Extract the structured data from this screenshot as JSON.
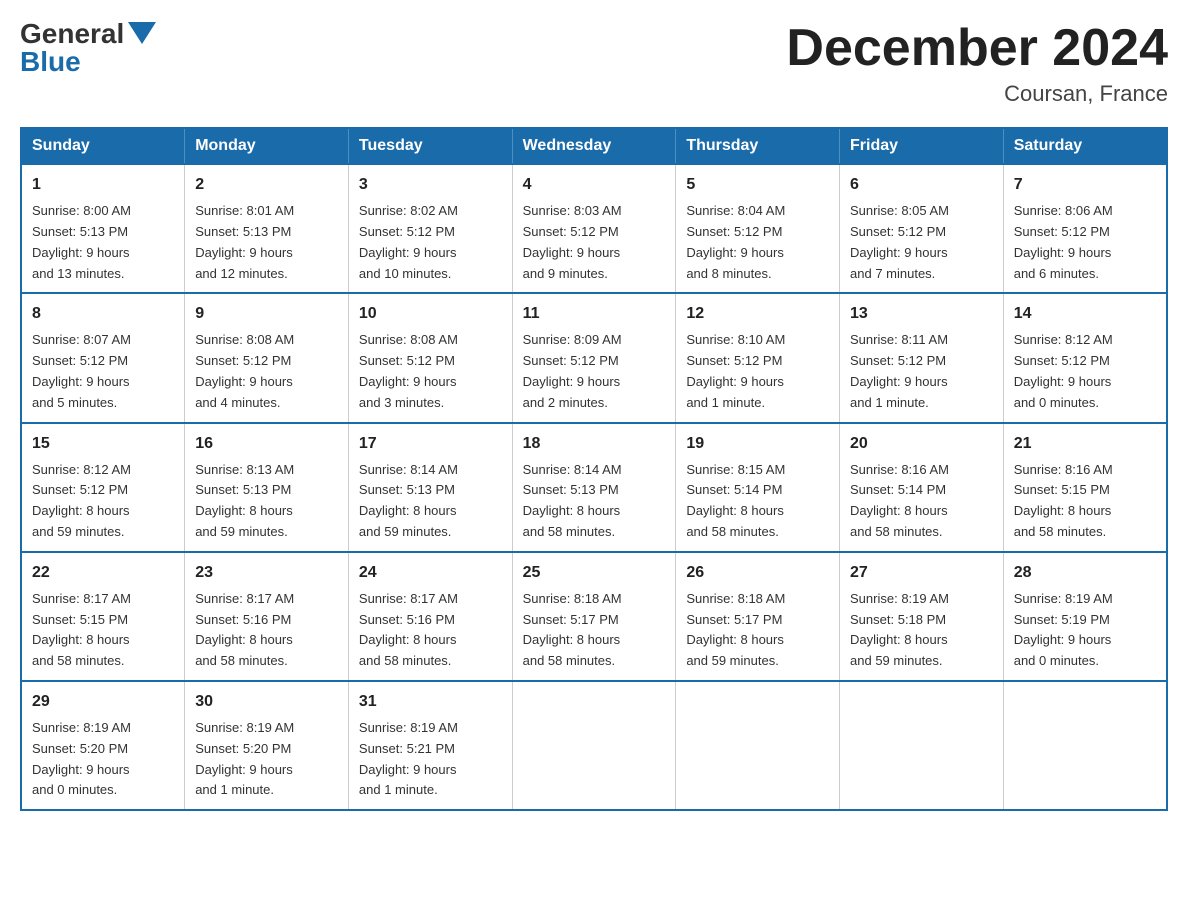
{
  "logo": {
    "text_general": "General",
    "text_blue": "Blue"
  },
  "title": {
    "month_year": "December 2024",
    "location": "Coursan, France"
  },
  "days_of_week": [
    "Sunday",
    "Monday",
    "Tuesday",
    "Wednesday",
    "Thursday",
    "Friday",
    "Saturday"
  ],
  "weeks": [
    [
      {
        "day": "1",
        "sunrise": "8:00 AM",
        "sunset": "5:13 PM",
        "daylight": "9 hours and 13 minutes."
      },
      {
        "day": "2",
        "sunrise": "8:01 AM",
        "sunset": "5:13 PM",
        "daylight": "9 hours and 12 minutes."
      },
      {
        "day": "3",
        "sunrise": "8:02 AM",
        "sunset": "5:12 PM",
        "daylight": "9 hours and 10 minutes."
      },
      {
        "day": "4",
        "sunrise": "8:03 AM",
        "sunset": "5:12 PM",
        "daylight": "9 hours and 9 minutes."
      },
      {
        "day": "5",
        "sunrise": "8:04 AM",
        "sunset": "5:12 PM",
        "daylight": "9 hours and 8 minutes."
      },
      {
        "day": "6",
        "sunrise": "8:05 AM",
        "sunset": "5:12 PM",
        "daylight": "9 hours and 7 minutes."
      },
      {
        "day": "7",
        "sunrise": "8:06 AM",
        "sunset": "5:12 PM",
        "daylight": "9 hours and 6 minutes."
      }
    ],
    [
      {
        "day": "8",
        "sunrise": "8:07 AM",
        "sunset": "5:12 PM",
        "daylight": "9 hours and 5 minutes."
      },
      {
        "day": "9",
        "sunrise": "8:08 AM",
        "sunset": "5:12 PM",
        "daylight": "9 hours and 4 minutes."
      },
      {
        "day": "10",
        "sunrise": "8:08 AM",
        "sunset": "5:12 PM",
        "daylight": "9 hours and 3 minutes."
      },
      {
        "day": "11",
        "sunrise": "8:09 AM",
        "sunset": "5:12 PM",
        "daylight": "9 hours and 2 minutes."
      },
      {
        "day": "12",
        "sunrise": "8:10 AM",
        "sunset": "5:12 PM",
        "daylight": "9 hours and 1 minute."
      },
      {
        "day": "13",
        "sunrise": "8:11 AM",
        "sunset": "5:12 PM",
        "daylight": "9 hours and 1 minute."
      },
      {
        "day": "14",
        "sunrise": "8:12 AM",
        "sunset": "5:12 PM",
        "daylight": "9 hours and 0 minutes."
      }
    ],
    [
      {
        "day": "15",
        "sunrise": "8:12 AM",
        "sunset": "5:12 PM",
        "daylight": "8 hours and 59 minutes."
      },
      {
        "day": "16",
        "sunrise": "8:13 AM",
        "sunset": "5:13 PM",
        "daylight": "8 hours and 59 minutes."
      },
      {
        "day": "17",
        "sunrise": "8:14 AM",
        "sunset": "5:13 PM",
        "daylight": "8 hours and 59 minutes."
      },
      {
        "day": "18",
        "sunrise": "8:14 AM",
        "sunset": "5:13 PM",
        "daylight": "8 hours and 58 minutes."
      },
      {
        "day": "19",
        "sunrise": "8:15 AM",
        "sunset": "5:14 PM",
        "daylight": "8 hours and 58 minutes."
      },
      {
        "day": "20",
        "sunrise": "8:16 AM",
        "sunset": "5:14 PM",
        "daylight": "8 hours and 58 minutes."
      },
      {
        "day": "21",
        "sunrise": "8:16 AM",
        "sunset": "5:15 PM",
        "daylight": "8 hours and 58 minutes."
      }
    ],
    [
      {
        "day": "22",
        "sunrise": "8:17 AM",
        "sunset": "5:15 PM",
        "daylight": "8 hours and 58 minutes."
      },
      {
        "day": "23",
        "sunrise": "8:17 AM",
        "sunset": "5:16 PM",
        "daylight": "8 hours and 58 minutes."
      },
      {
        "day": "24",
        "sunrise": "8:17 AM",
        "sunset": "5:16 PM",
        "daylight": "8 hours and 58 minutes."
      },
      {
        "day": "25",
        "sunrise": "8:18 AM",
        "sunset": "5:17 PM",
        "daylight": "8 hours and 58 minutes."
      },
      {
        "day": "26",
        "sunrise": "8:18 AM",
        "sunset": "5:17 PM",
        "daylight": "8 hours and 59 minutes."
      },
      {
        "day": "27",
        "sunrise": "8:19 AM",
        "sunset": "5:18 PM",
        "daylight": "8 hours and 59 minutes."
      },
      {
        "day": "28",
        "sunrise": "8:19 AM",
        "sunset": "5:19 PM",
        "daylight": "9 hours and 0 minutes."
      }
    ],
    [
      {
        "day": "29",
        "sunrise": "8:19 AM",
        "sunset": "5:20 PM",
        "daylight": "9 hours and 0 minutes."
      },
      {
        "day": "30",
        "sunrise": "8:19 AM",
        "sunset": "5:20 PM",
        "daylight": "9 hours and 1 minute."
      },
      {
        "day": "31",
        "sunrise": "8:19 AM",
        "sunset": "5:21 PM",
        "daylight": "9 hours and 1 minute."
      },
      null,
      null,
      null,
      null
    ]
  ],
  "labels": {
    "sunrise": "Sunrise:",
    "sunset": "Sunset:",
    "daylight": "Daylight:"
  }
}
